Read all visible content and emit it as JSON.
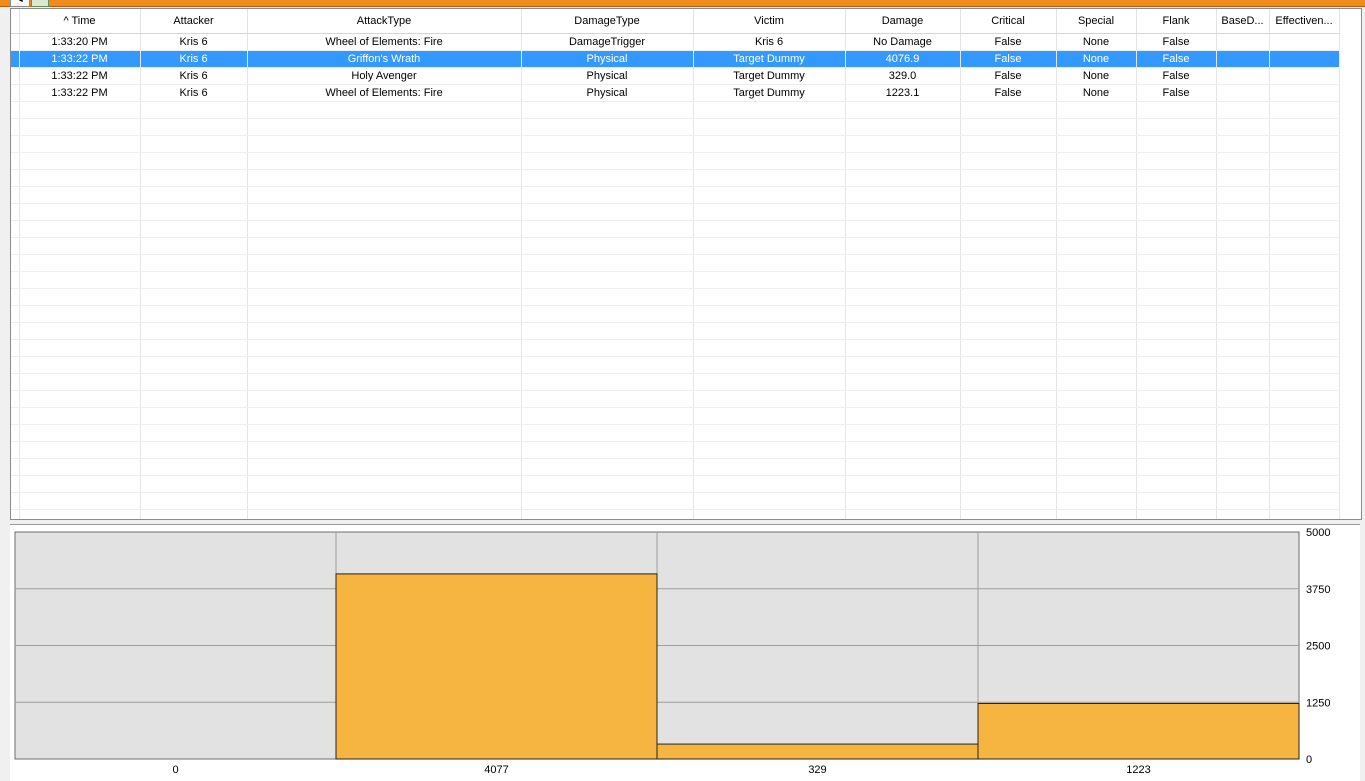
{
  "toolbar": {
    "back_glyph": "◄",
    "export_icon": "excel-export-icon"
  },
  "grid": {
    "columns": [
      "^ Time",
      "Attacker",
      "AttackType",
      "DamageType",
      "Victim",
      "Damage",
      "Critical",
      "Special",
      "Flank",
      "BaseD...",
      "Effectiven..."
    ],
    "rows": [
      [
        "1:33:20 PM",
        "Kris 6",
        "Wheel of Elements: Fire",
        "DamageTrigger",
        "Kris 6",
        "No Damage",
        "False",
        "None",
        "False",
        "",
        ""
      ],
      [
        "1:33:22 PM",
        "Kris 6",
        "Griffon's Wrath",
        "Physical",
        "Target Dummy",
        "4076.9",
        "False",
        "None",
        "False",
        "",
        ""
      ],
      [
        "1:33:22 PM",
        "Kris 6",
        "Holy Avenger",
        "Physical",
        "Target Dummy",
        "329.0",
        "False",
        "None",
        "False",
        "",
        ""
      ],
      [
        "1:33:22 PM",
        "Kris 6",
        "Wheel of Elements: Fire",
        "Physical",
        "Target Dummy",
        "1223.1",
        "False",
        "None",
        "False",
        "",
        ""
      ]
    ],
    "selected_row": 1
  },
  "chart_data": {
    "type": "bar",
    "categories": [
      "0",
      "4077",
      "329",
      "1223"
    ],
    "values": [
      0,
      4077,
      329,
      1223
    ],
    "ylim": [
      0,
      5000
    ],
    "yticks": [
      0,
      1250,
      2500,
      3750,
      5000
    ],
    "bar_color": "#f5b540",
    "grid": true,
    "y_axis_side": "right"
  }
}
